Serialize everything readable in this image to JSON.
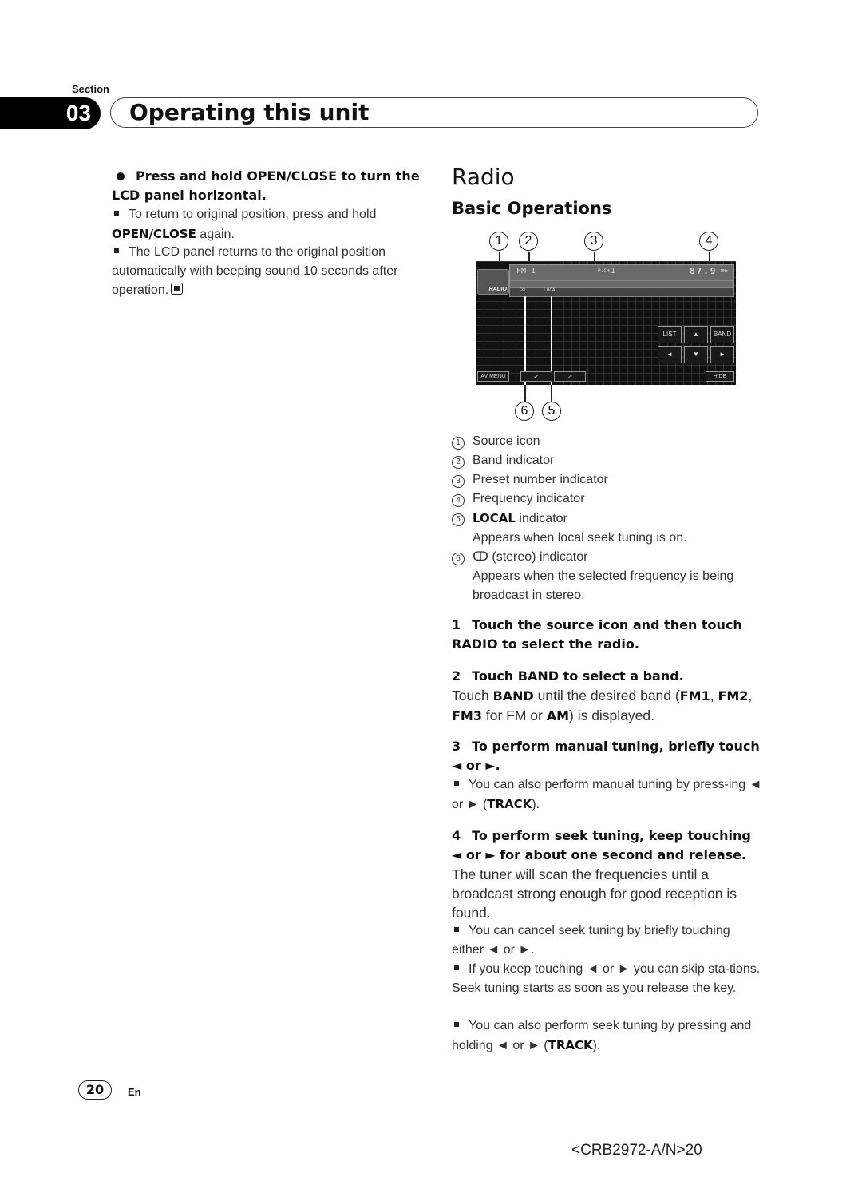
{
  "header": {
    "section_label": "Section",
    "section_number": "03",
    "title": "Operating this unit"
  },
  "left": {
    "heading": "Press and hold OPEN/CLOSE to turn the LCD panel horizontal.",
    "notes": [
      {
        "pre": "To return to original position, press and hold ",
        "bold": "OPEN/CLOSE",
        "post": " again."
      },
      {
        "pre": "The LCD panel returns to the original position automatically with beeping sound 10 seconds after operation.",
        "bold": "",
        "post": ""
      }
    ]
  },
  "right": {
    "title": "Radio",
    "subtitle": "Basic Operations",
    "figure": {
      "callouts_top": [
        "1",
        "2",
        "3",
        "4"
      ],
      "callouts_bottom": [
        "6",
        "5"
      ],
      "screen": {
        "source_label": "RADIO",
        "band": "FM 1",
        "preset_label": "P.CH",
        "preset": "1",
        "frequency": "87.9",
        "frequency_unit": "MHz",
        "stereo_symbol": "○○",
        "local": "LOCAL",
        "buttons": {
          "list": "LIST",
          "up": "▲",
          "band": "BAND",
          "left": "◄",
          "down": "▼",
          "right": "►",
          "av_menu": "AV MENU",
          "seek1": "↙",
          "seek2": "↗",
          "hide": "HIDE"
        }
      }
    },
    "legend": [
      {
        "num": "1",
        "bold": "",
        "text": "Source icon",
        "desc": ""
      },
      {
        "num": "2",
        "bold": "",
        "text": "Band indicator",
        "desc": ""
      },
      {
        "num": "3",
        "bold": "",
        "text": "Preset number indicator",
        "desc": ""
      },
      {
        "num": "4",
        "bold": "",
        "text": "Frequency indicator",
        "desc": ""
      },
      {
        "num": "5",
        "bold": "LOCAL",
        "text": " indicator",
        "desc": "Appears when local seek tuning is on."
      },
      {
        "num": "6",
        "bold": "",
        "text": "ↀ (stereo) indicator",
        "desc": "Appears when the selected frequency is being broadcast in stereo."
      }
    ],
    "steps": [
      {
        "n": "1",
        "heading": "Touch the source icon and then touch RADIO to select the radio."
      },
      {
        "n": "2",
        "heading": "Touch BAND to select a band."
      },
      {
        "n": "3",
        "heading": "To perform manual tuning, briefly touch ◄ or ►."
      },
      {
        "n": "4",
        "heading": "To perform seek tuning, keep touching ◄ or ► for about one second and release."
      }
    ],
    "step2_body": {
      "a": "Touch ",
      "b1": "BAND",
      "c": " until the desired band (",
      "b2": "FM1",
      "d": ", ",
      "b3": "FM2",
      "e": ", ",
      "b4": "FM3",
      "f": " for FM or ",
      "b5": "AM",
      "g": ") is displayed."
    },
    "step3_note": {
      "pre": "You can also perform manual tuning by press-ing ◄ or ► (",
      "bold": "TRACK",
      "post": ")."
    },
    "step4_body": "The tuner will scan the frequencies until a broadcast strong enough for good reception is found.",
    "step4_notes": [
      {
        "pre": "You can cancel seek tuning by briefly touching either ◄ or ►.",
        "bold": "",
        "post": ""
      },
      {
        "pre": "If you keep touching ◄ or ► you can skip sta-tions. Seek tuning starts as soon as you release the key.",
        "bold": "",
        "post": ""
      },
      {
        "pre": "You can also perform seek tuning by pressing and holding ◄ or ► (",
        "bold": "TRACK",
        "post": ")."
      }
    ]
  },
  "footer": {
    "page_number": "20",
    "language": "En",
    "doc_ref": "<CRB2972-A/N>20"
  }
}
